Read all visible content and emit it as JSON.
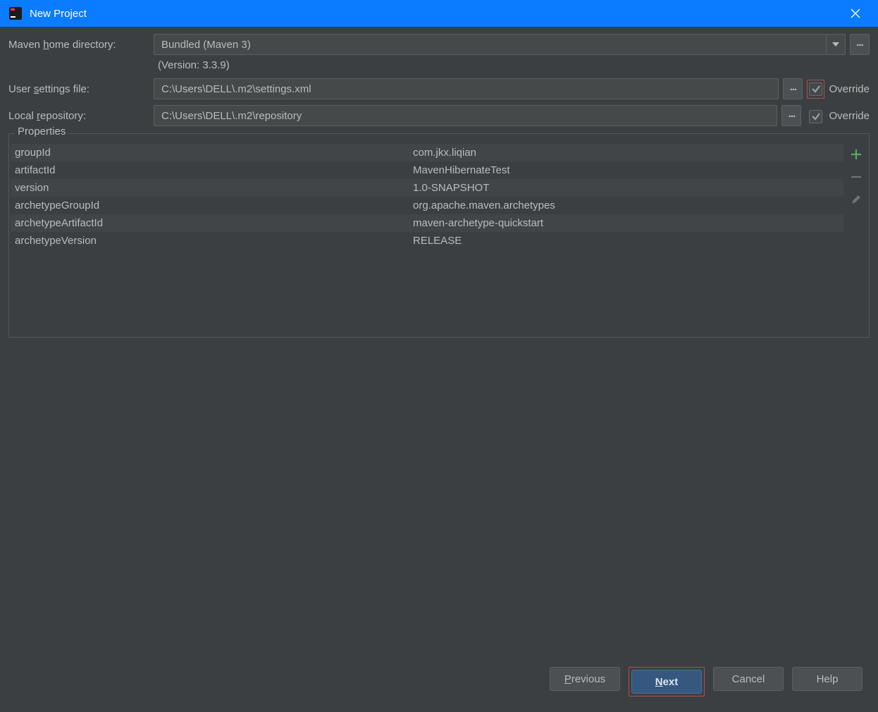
{
  "window": {
    "title": "New Project"
  },
  "labels": {
    "maven_home_pre": "Maven ",
    "maven_home_m": "h",
    "maven_home_post": "ome directory:",
    "user_settings_pre": "User ",
    "user_settings_m": "s",
    "user_settings_post": "ettings file:",
    "local_repo_pre": "Local ",
    "local_repo_m": "r",
    "local_repo_post": "epository:",
    "version_text": "(Version: 3.3.9)",
    "override": "Override",
    "properties_legend": "Properties"
  },
  "fields": {
    "maven_home_value": "Bundled (Maven 3)",
    "user_settings_value": "C:\\Users\\DELL\\.m2\\settings.xml",
    "local_repo_value": "C:\\Users\\DELL\\.m2\\repository",
    "browse_dots": "..."
  },
  "properties": [
    {
      "key": "groupId",
      "value": "com.jkx.liqian"
    },
    {
      "key": "artifactId",
      "value": "MavenHibernateTest"
    },
    {
      "key": "version",
      "value": "1.0-SNAPSHOT"
    },
    {
      "key": "archetypeGroupId",
      "value": "org.apache.maven.archetypes"
    },
    {
      "key": "archetypeArtifactId",
      "value": "maven-archetype-quickstart"
    },
    {
      "key": "archetypeVersion",
      "value": "RELEASE"
    }
  ],
  "buttons": {
    "previous_m": "P",
    "previous_rest": "revious",
    "next_m": "N",
    "next_rest": "ext",
    "cancel": "Cancel",
    "help": "Help"
  }
}
